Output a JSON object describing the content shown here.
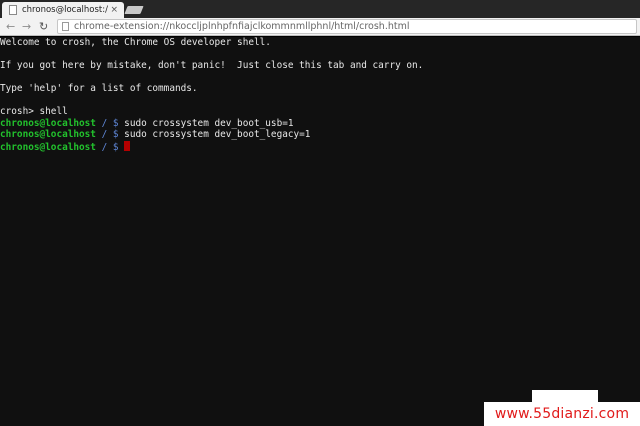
{
  "browser": {
    "tab_title": "chronos@localhost:/",
    "tab_close": "×",
    "url": "chrome-extension://nkoccljplnhpfnfiajclkommnmllphnl/html/crosh.html",
    "icons": {
      "back": "arrow-left-icon",
      "forward": "arrow-right-icon",
      "reload": "reload-icon",
      "page": "page-icon"
    }
  },
  "terminal": {
    "lines": [
      {
        "text": "Welcome to crosh, the Chrome OS developer shell."
      },
      {
        "text": ""
      },
      {
        "text": "If you got here by mistake, don't panic!  Just close this tab and carry on."
      },
      {
        "text": ""
      },
      {
        "text": "Type 'help' for a list of commands."
      },
      {
        "text": ""
      },
      {
        "text": "crosh> shell"
      },
      {
        "user": "chronos@localhost",
        "path": " / $",
        "cmd": " sudo crossystem dev_boot_usb=1"
      },
      {
        "user": "chronos@localhost",
        "path": " / $",
        "cmd": " sudo crossystem dev_boot_legacy=1"
      },
      {
        "user": "chronos@localhost",
        "path": " / $",
        "cmd": " ",
        "cursor": true
      }
    ],
    "colors": {
      "user": "#22c22d",
      "path": "#5f87d7",
      "cursor": "#b40000"
    }
  },
  "watermark": "www.55dianzi.com"
}
